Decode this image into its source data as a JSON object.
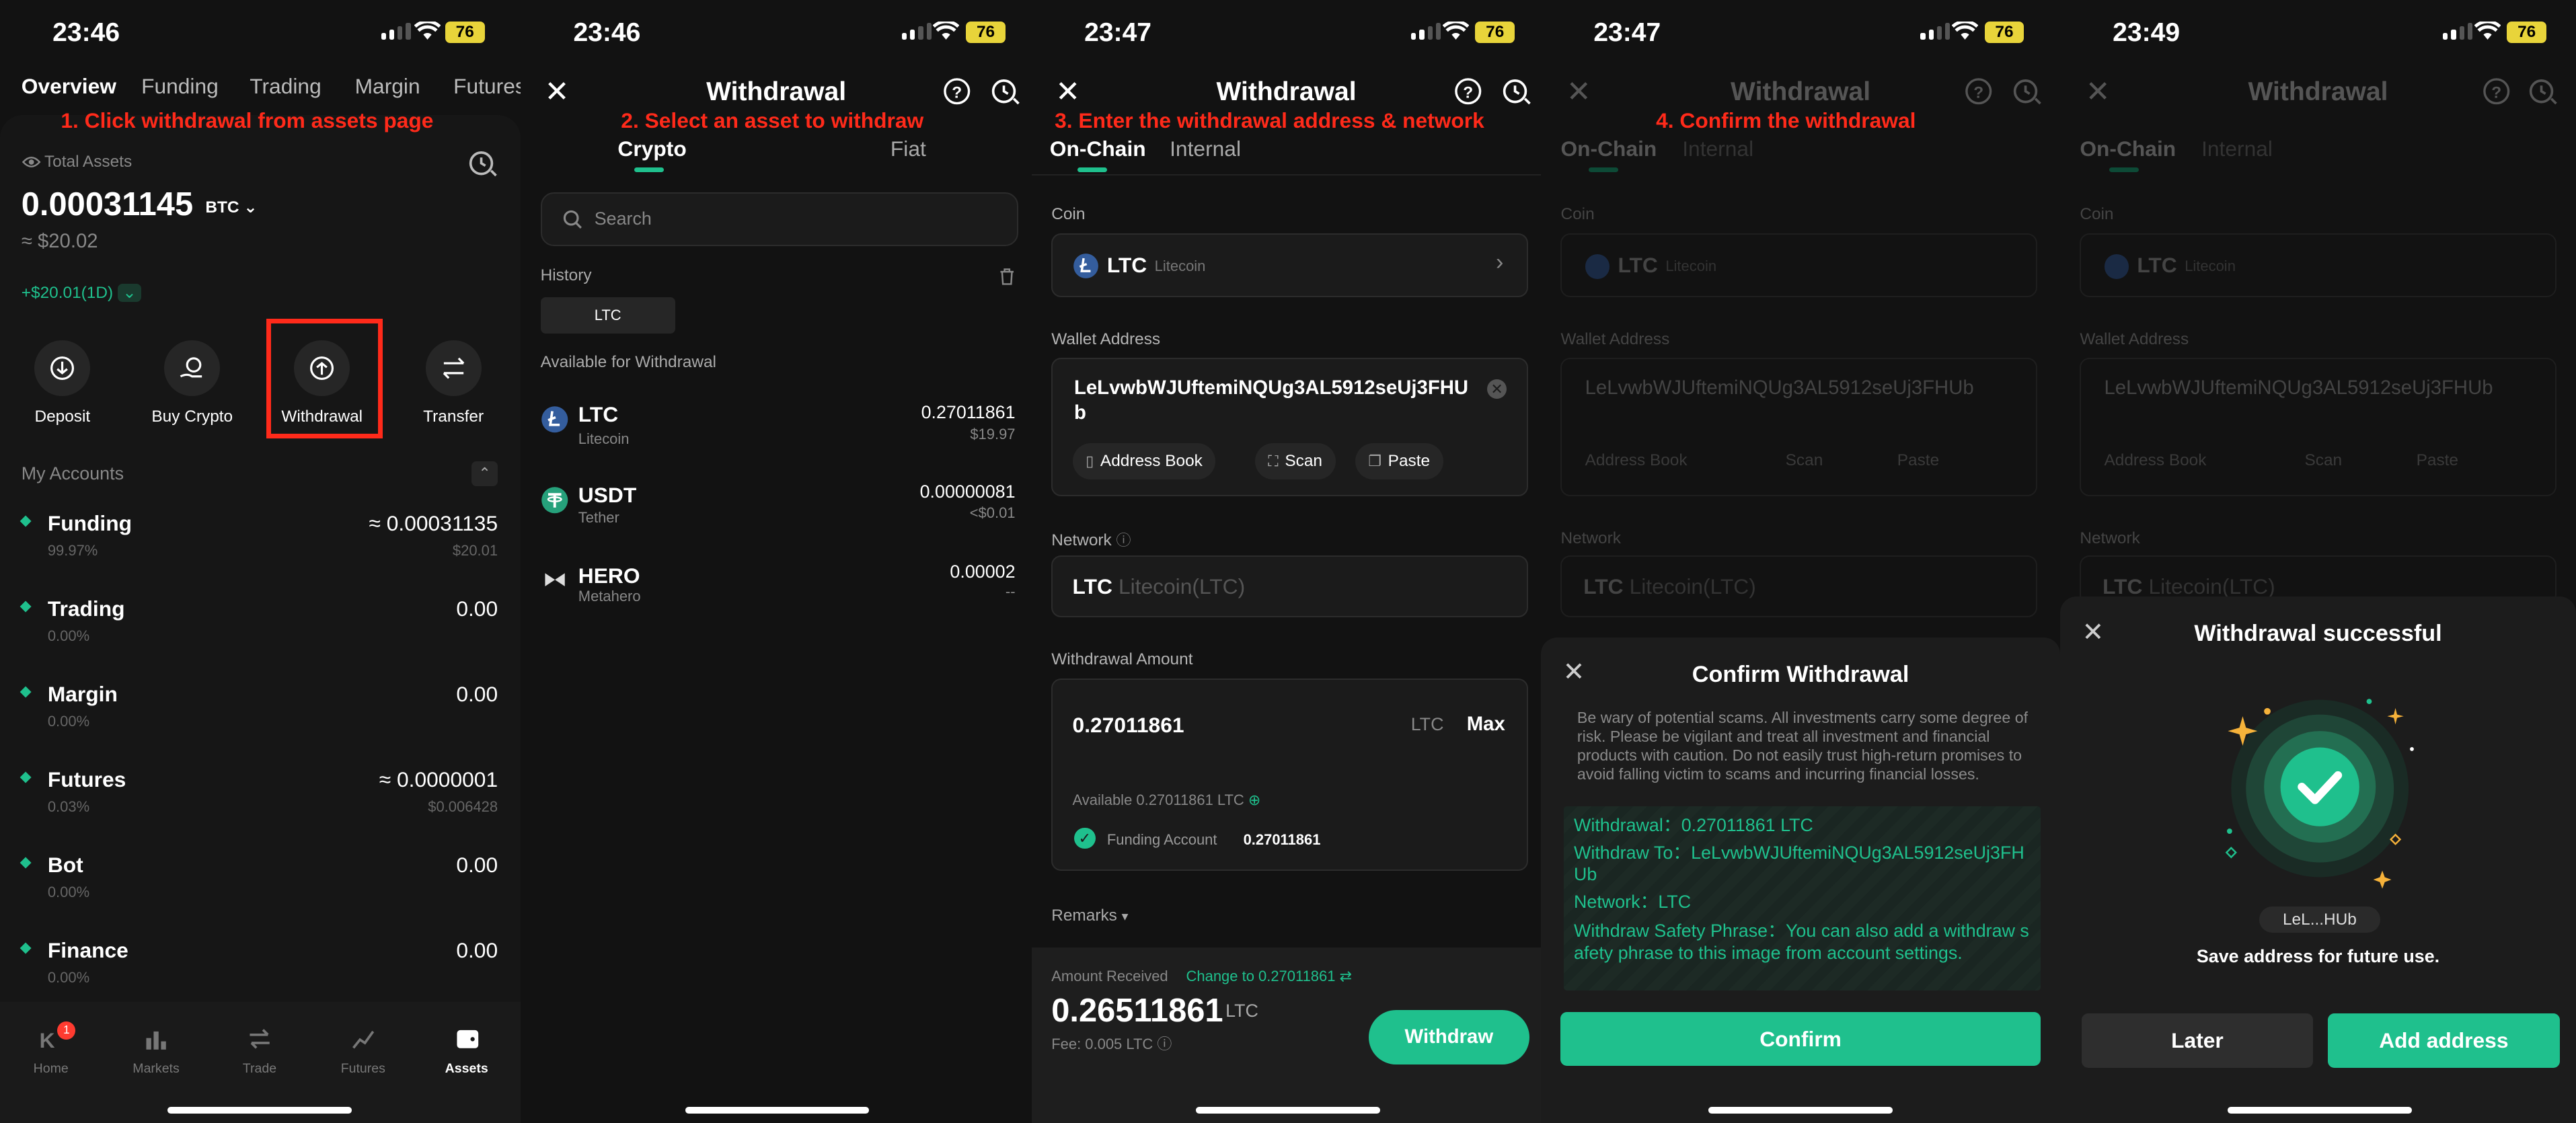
{
  "status": {
    "time1": "23:46",
    "time2": "23:46",
    "time3": "23:47",
    "time4": "23:47",
    "time5": "23:49",
    "battery": "76"
  },
  "annotations": {
    "step1": "1. Click withdrawal from assets page",
    "step2": "2. Select an asset to withdraw",
    "step3": "3. Enter the withdrawal address & network",
    "step4": "4. Confirm the withdrawal"
  },
  "assets_page": {
    "tabs": [
      "Overview",
      "Funding",
      "Trading",
      "Margin",
      "Futures"
    ],
    "total_assets_label": "Total Assets",
    "total_value": "0.00031145",
    "total_unit": "BTC",
    "fiat_value": "≈ $20.02",
    "change": "+$20.01(1D)",
    "actions": [
      "Deposit",
      "Buy Crypto",
      "Withdrawal",
      "Transfer"
    ],
    "my_accounts_label": "My Accounts",
    "accounts": [
      {
        "name": "Funding",
        "pct": "99.97%",
        "value": "≈ 0.00031135",
        "sub": "$20.01"
      },
      {
        "name": "Trading",
        "pct": "0.00%",
        "value": "0.00",
        "sub": ""
      },
      {
        "name": "Margin",
        "pct": "0.00%",
        "value": "0.00",
        "sub": ""
      },
      {
        "name": "Futures",
        "pct": "0.03%",
        "value": "≈ 0.0000001",
        "sub": "$0.006428"
      },
      {
        "name": "Bot",
        "pct": "0.00%",
        "value": "0.00",
        "sub": ""
      },
      {
        "name": "Finance",
        "pct": "0.00%",
        "value": "0.00",
        "sub": ""
      }
    ],
    "bottom_nav": [
      "Home",
      "Markets",
      "Trade",
      "Futures",
      "Assets"
    ],
    "home_badge": "1"
  },
  "select_asset": {
    "title": "Withdrawal",
    "tabs": [
      "Crypto",
      "Fiat"
    ],
    "search_placeholder": "Search",
    "history_label": "History",
    "history_chip": "LTC",
    "available_label": "Available for Withdrawal",
    "assets": [
      {
        "symbol": "LTC",
        "name": "Litecoin",
        "amount": "0.27011861",
        "fiat": "$19.97"
      },
      {
        "symbol": "USDT",
        "name": "Tether",
        "amount": "0.00000081",
        "fiat": "<$0.01"
      },
      {
        "symbol": "HERO",
        "name": "Metahero",
        "amount": "0.00002",
        "fiat": "--"
      }
    ]
  },
  "form": {
    "title": "Withdrawal",
    "tabs": [
      "On-Chain",
      "Internal"
    ],
    "coin_label": "Coin",
    "coin_symbol": "LTC",
    "coin_name": "Litecoin",
    "wallet_label": "Wallet Address",
    "wallet_address": "LeLvwbWJUftemiNQUg3AL5912seUj3FHUb",
    "address_book": "Address Book",
    "scan": "Scan",
    "paste": "Paste",
    "network_label": "Network",
    "network_symbol": "LTC",
    "network_name": "Litecoin(LTC)",
    "amount_label": "Withdrawal Amount",
    "amount": "0.27011861",
    "amount_unit": "LTC",
    "max": "Max",
    "available": "Available 0.27011861 LTC",
    "funding_account": "Funding Account",
    "funding_amount": "0.27011861",
    "remarks": "Remarks",
    "received_label": "Amount Received",
    "change_to": "Change to 0.27011861",
    "received_value": "0.26511861",
    "received_unit": "LTC",
    "fee": "Fee: 0.005 LTC",
    "withdraw_button": "Withdraw"
  },
  "confirm": {
    "title": "Confirm Withdrawal",
    "warning": "Be wary of potential scams. All investments carry some degree of risk. Please be vigilant and treat all investment and financial products with caution. Do not easily trust high-return promises to avoid falling victim to scams and incurring financial losses.",
    "line1": "Withdrawal：0.27011861 LTC",
    "line2": "Withdraw To：LeLvwbWJUftemiNQUg3AL5912seUj3FHUb",
    "line3": "Network：LTC",
    "line4": "Withdraw Safety Phrase：You can also add a withdraw safety phrase to this image from account settings.",
    "confirm_button": "Confirm"
  },
  "success": {
    "title": "Withdrawal successful",
    "address_short": "LeL...HUb",
    "save_text": "Save address for future use.",
    "later_button": "Later",
    "add_button": "Add address"
  },
  "colors": {
    "accent": "#1fc08d",
    "annotation": "#ff2a1a",
    "background": "#121212"
  }
}
